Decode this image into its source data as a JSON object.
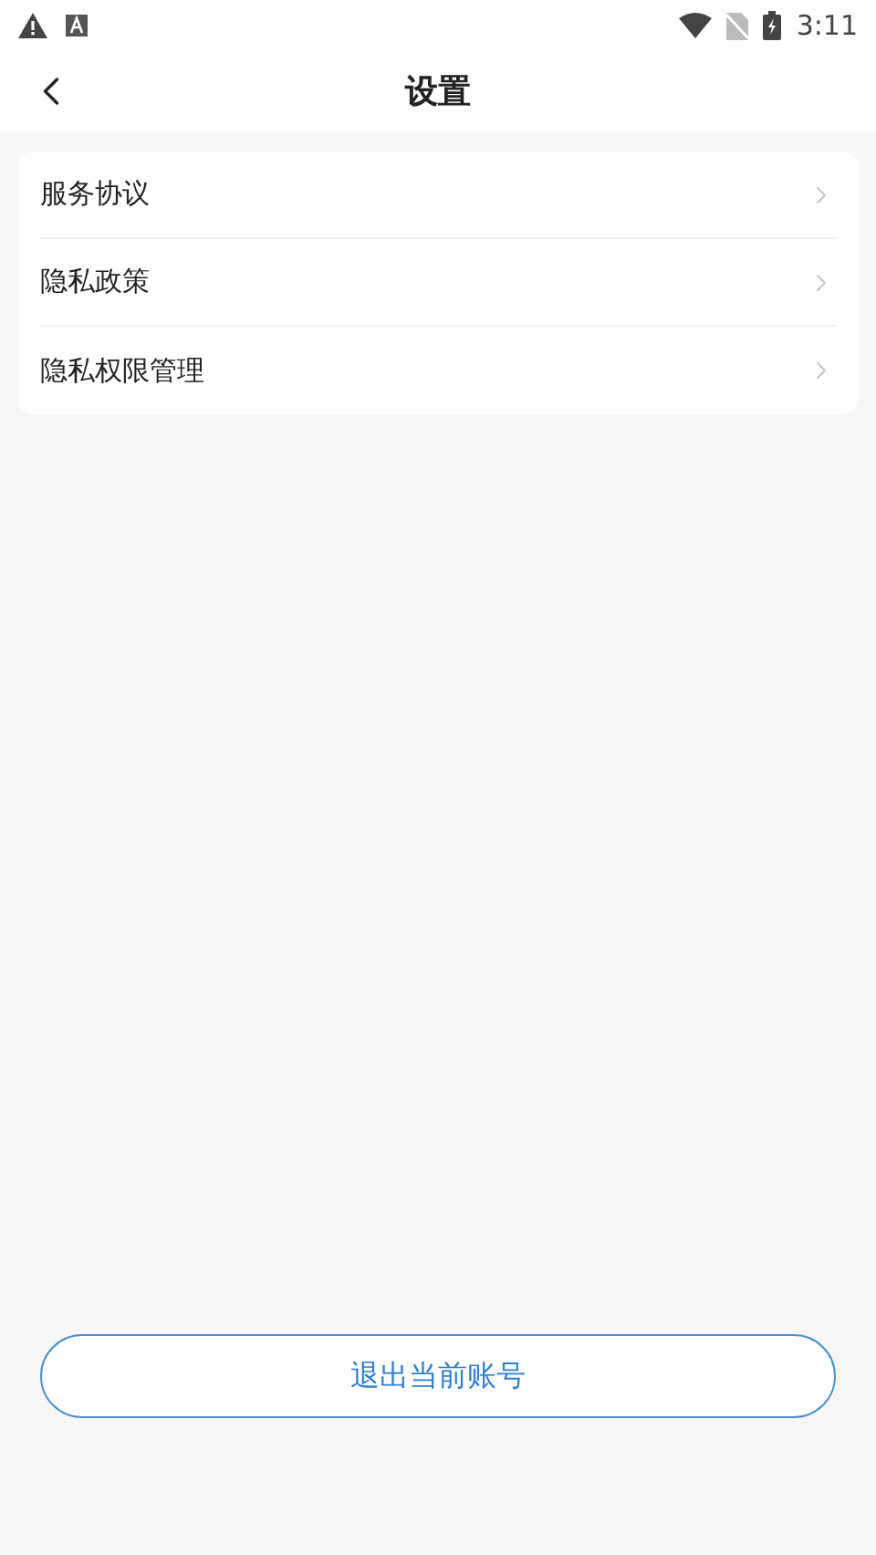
{
  "status_bar": {
    "time": "3:11"
  },
  "header": {
    "title": "设置"
  },
  "menu": {
    "items": [
      {
        "label": "服务协议"
      },
      {
        "label": "隐私政策"
      },
      {
        "label": "隐私权限管理"
      }
    ]
  },
  "logout_button": {
    "label": "退出当前账号"
  }
}
